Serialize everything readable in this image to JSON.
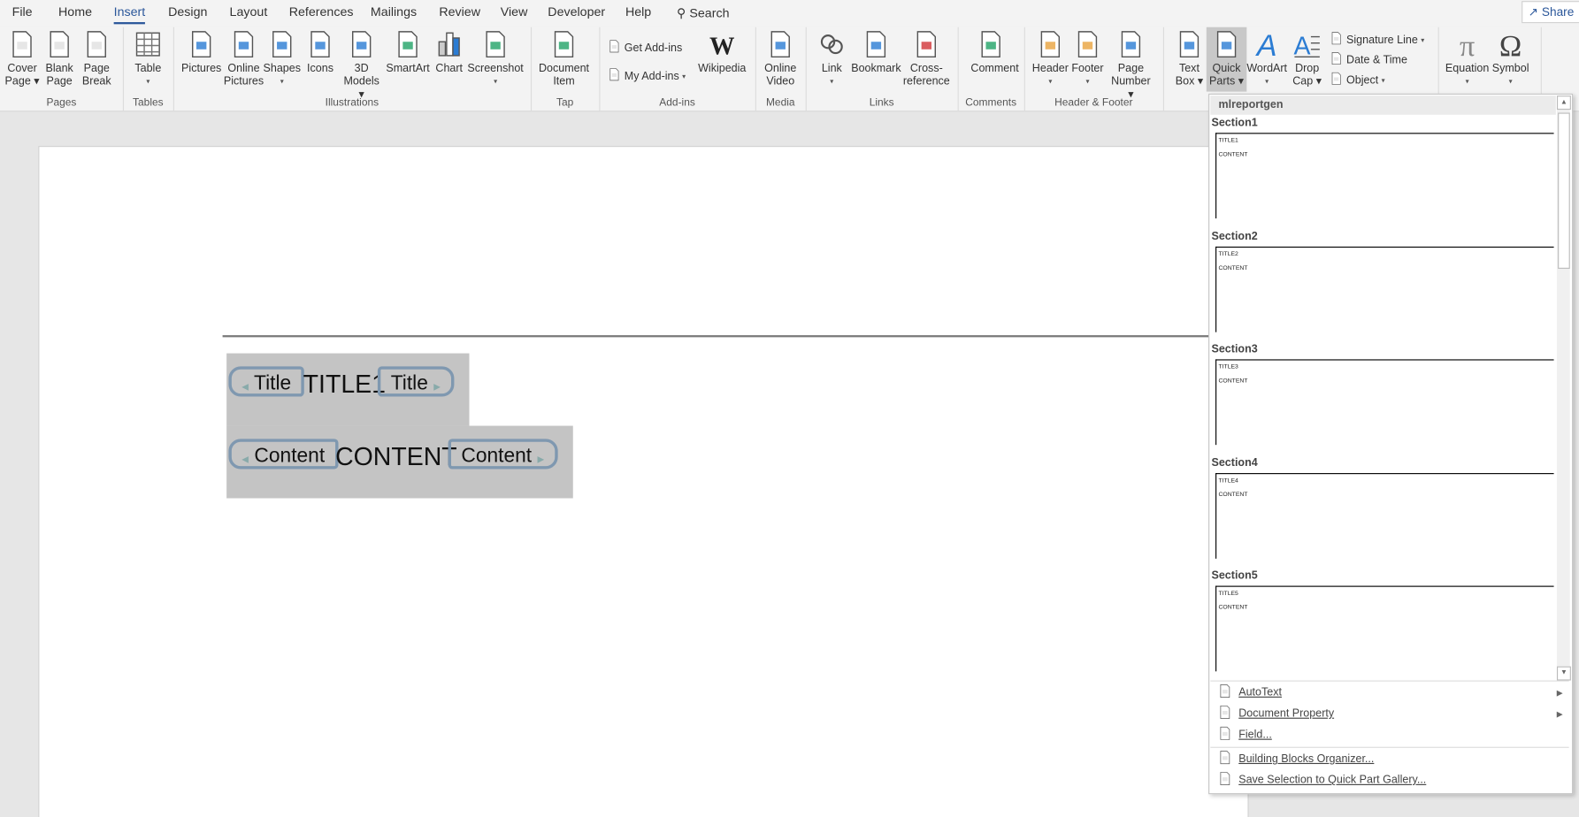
{
  "tabs": [
    "File",
    "Home",
    "Insert",
    "Design",
    "Layout",
    "References",
    "Mailings",
    "Review",
    "View",
    "Developer",
    "Help"
  ],
  "active_tab": "Insert",
  "search": "Search",
  "share": "Share",
  "accent": "#2b579a",
  "groups": [
    {
      "label": "Pages",
      "buttons": [
        {
          "l1": "Cover",
          "l2": "Page",
          "drop": true,
          "icon": "cover-page-icon"
        },
        {
          "l1": "Blank",
          "l2": "Page",
          "icon": "blank-page-icon"
        },
        {
          "l1": "Page",
          "l2": "Break",
          "icon": "page-break-icon"
        }
      ]
    },
    {
      "label": "Tables",
      "buttons": [
        {
          "l1": "Table",
          "l2": "",
          "drop": true,
          "icon": "table-icon"
        }
      ]
    },
    {
      "label": "Illustrations",
      "buttons": [
        {
          "l1": "Pictures",
          "l2": "",
          "icon": "pictures-icon"
        },
        {
          "l1": "Online",
          "l2": "Pictures",
          "icon": "online-pictures-icon"
        },
        {
          "l1": "Shapes",
          "l2": "",
          "drop": true,
          "icon": "shapes-icon"
        },
        {
          "l1": "Icons",
          "l2": "",
          "icon": "icons-icon"
        },
        {
          "l1": "3D",
          "l2": "Models",
          "drop": true,
          "icon": "3d-models-icon"
        },
        {
          "l1": "SmartArt",
          "l2": "",
          "icon": "smartart-icon"
        },
        {
          "l1": "Chart",
          "l2": "",
          "icon": "chart-icon"
        },
        {
          "l1": "Screenshot",
          "l2": "",
          "drop": true,
          "icon": "screenshot-icon"
        }
      ]
    },
    {
      "label": "Tap",
      "buttons": [
        {
          "l1": "Document",
          "l2": "Item",
          "icon": "document-item-icon"
        }
      ]
    },
    {
      "label": "Add-ins",
      "small": [
        {
          "label": "Get Add-ins",
          "icon": "store-icon"
        },
        {
          "label": "My Add-ins",
          "icon": "my-addins-icon",
          "drop": true
        }
      ],
      "buttons": [
        {
          "l1": "Wikipedia",
          "l2": "",
          "icon": "wikipedia-icon"
        }
      ]
    },
    {
      "label": "Media",
      "buttons": [
        {
          "l1": "Online",
          "l2": "Video",
          "icon": "online-video-icon"
        }
      ]
    },
    {
      "label": "Links",
      "buttons": [
        {
          "l1": "Link",
          "l2": "",
          "drop": true,
          "icon": "link-icon"
        },
        {
          "l1": "Bookmark",
          "l2": "",
          "icon": "bookmark-icon"
        },
        {
          "l1": "Cross-",
          "l2": "reference",
          "icon": "cross-reference-icon"
        }
      ]
    },
    {
      "label": "Comments",
      "buttons": [
        {
          "l1": "Comment",
          "l2": "",
          "icon": "comment-icon"
        }
      ]
    },
    {
      "label": "Header & Footer",
      "buttons": [
        {
          "l1": "Header",
          "l2": "",
          "drop": true,
          "icon": "header-icon"
        },
        {
          "l1": "Footer",
          "l2": "",
          "drop": true,
          "icon": "footer-icon"
        },
        {
          "l1": "Page",
          "l2": "Number",
          "drop": true,
          "icon": "page-number-icon"
        }
      ]
    },
    {
      "label": "",
      "buttons": [
        {
          "l1": "Text",
          "l2": "Box",
          "drop": true,
          "icon": "text-box-icon"
        },
        {
          "l1": "Quick",
          "l2": "Parts",
          "drop": true,
          "icon": "quick-parts-icon",
          "selected": true
        },
        {
          "l1": "WordArt",
          "l2": "",
          "drop": true,
          "icon": "wordart-icon"
        },
        {
          "l1": "Drop",
          "l2": "Cap",
          "drop": true,
          "icon": "drop-cap-icon"
        }
      ],
      "small": [
        {
          "label": "Signature Line",
          "icon": "signature-line-icon",
          "drop": true
        },
        {
          "label": "Date & Time",
          "icon": "date-time-icon"
        },
        {
          "label": "Object",
          "icon": "object-icon",
          "drop": true
        }
      ]
    },
    {
      "label": "",
      "buttons": [
        {
          "l1": "Equation",
          "l2": "",
          "drop": true,
          "icon": "equation-icon"
        },
        {
          "l1": "Symbol",
          "l2": "",
          "drop": true,
          "icon": "symbol-icon"
        }
      ]
    }
  ],
  "document": {
    "title_tag": "Title",
    "title_value": "TITLE1",
    "content_tag": "Content",
    "content_value": "CONTENT"
  },
  "quick_parts": {
    "category": "mlreportgen",
    "sections": [
      {
        "name": "Section1",
        "title": "TITLE1",
        "content": "CONTENT"
      },
      {
        "name": "Section2",
        "title": "TITLE2",
        "content": "CONTENT"
      },
      {
        "name": "Section3",
        "title": "TITLE3",
        "content": "CONTENT"
      },
      {
        "name": "Section4",
        "title": "TITLE4",
        "content": "CONTENT"
      },
      {
        "name": "Section5",
        "title": "TITLE5",
        "content": "CONTENT"
      }
    ],
    "menu": [
      {
        "label": "AutoText",
        "icon": "autotext-icon",
        "submenu": true
      },
      {
        "label": "Document Property",
        "icon": "document-property-icon",
        "submenu": true
      },
      {
        "label": "Field...",
        "icon": "field-icon"
      },
      {
        "label": "Building Blocks Organizer...",
        "icon": "building-blocks-icon"
      },
      {
        "label": "Save Selection to Quick Part Gallery...",
        "icon": "save-selection-icon"
      }
    ]
  }
}
